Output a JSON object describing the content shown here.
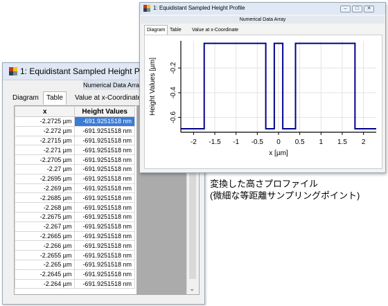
{
  "back_window": {
    "title": "1: Equidistant Sampled Height Profile",
    "subheader": "Numerical Data Array",
    "tabs": [
      "Diagram",
      "Table",
      "Value at x-Coordinate"
    ],
    "table": {
      "columns": [
        "x",
        "Height Values"
      ],
      "rows": [
        [
          "-2.2725 µm",
          "-691.9251518 nm"
        ],
        [
          "-2.272 µm",
          "-691.9251518 nm"
        ],
        [
          "-2.2715 µm",
          "-691.9251518 nm"
        ],
        [
          "-2.271 µm",
          "-691.9251518 nm"
        ],
        [
          "-2.2705 µm",
          "-691.9251518 nm"
        ],
        [
          "-2.27 µm",
          "-691.9251518 nm"
        ],
        [
          "-2.2695 µm",
          "-691.9251518 nm"
        ],
        [
          "-2.269 µm",
          "-691.9251518 nm"
        ],
        [
          "-2.2685 µm",
          "-691.9251518 nm"
        ],
        [
          "-2.268 µm",
          "-691.9251518 nm"
        ],
        [
          "-2.2675 µm",
          "-691.9251518 nm"
        ],
        [
          "-2.267 µm",
          "-691.9251518 nm"
        ],
        [
          "-2.2665 µm",
          "-691.9251518 nm"
        ],
        [
          "-2.266 µm",
          "-691.9251518 nm"
        ],
        [
          "-2.2655 µm",
          "-691.9251518 nm"
        ],
        [
          "-2.265 µm",
          "-691.9251518 nm"
        ],
        [
          "-2.2645 µm",
          "-691.9251518 nm"
        ],
        [
          "-2.264 µm",
          "-691.9251518 nm"
        ]
      ]
    },
    "scroll_arrow": "⌄"
  },
  "front_window": {
    "title": "1: Equidistant Sampled Height Profile",
    "subheader": "Numerical Data Array",
    "tabs": [
      "Diagram",
      "Table",
      "Value at x-Coordinate"
    ],
    "controls": {
      "minimize": "–",
      "maximize": "□",
      "close": "✕"
    }
  },
  "chart_data": {
    "type": "line",
    "xlabel": "x [µm]",
    "ylabel": "Height Values [µm]",
    "xlim": [
      -2.3,
      2.3
    ],
    "ylim": [
      -0.72,
      0.02
    ],
    "x_ticks": [
      -2,
      -1.5,
      -1,
      -0.5,
      0,
      0.5,
      1,
      1.5,
      2
    ],
    "x_tick_labels": [
      "-2",
      "-1.5",
      "-1",
      "-0.5",
      "0",
      "0.5",
      "1",
      "1.5",
      "2"
    ],
    "y_ticks": [
      -0.2,
      -0.4,
      -0.6
    ],
    "y_tick_labels": [
      "-0.2",
      "-0.4",
      "-0.6"
    ],
    "grid": true,
    "line_color": "#00008b",
    "series": [
      {
        "x": [
          -2.3,
          -1.75,
          -1.75,
          -0.3,
          -0.3,
          -0.1,
          -0.1,
          0.1,
          0.1,
          0.4,
          0.4,
          1.8,
          1.8,
          2.3
        ],
        "y": [
          -0.692,
          -0.692,
          0,
          0,
          -0.692,
          -0.692,
          0,
          0,
          -0.692,
          -0.692,
          0,
          0,
          -0.692,
          -0.692
        ]
      }
    ]
  },
  "note": {
    "line1": "変換した高さプロファイル",
    "line2": "(微細な等距離サンプリングポイント)"
  }
}
